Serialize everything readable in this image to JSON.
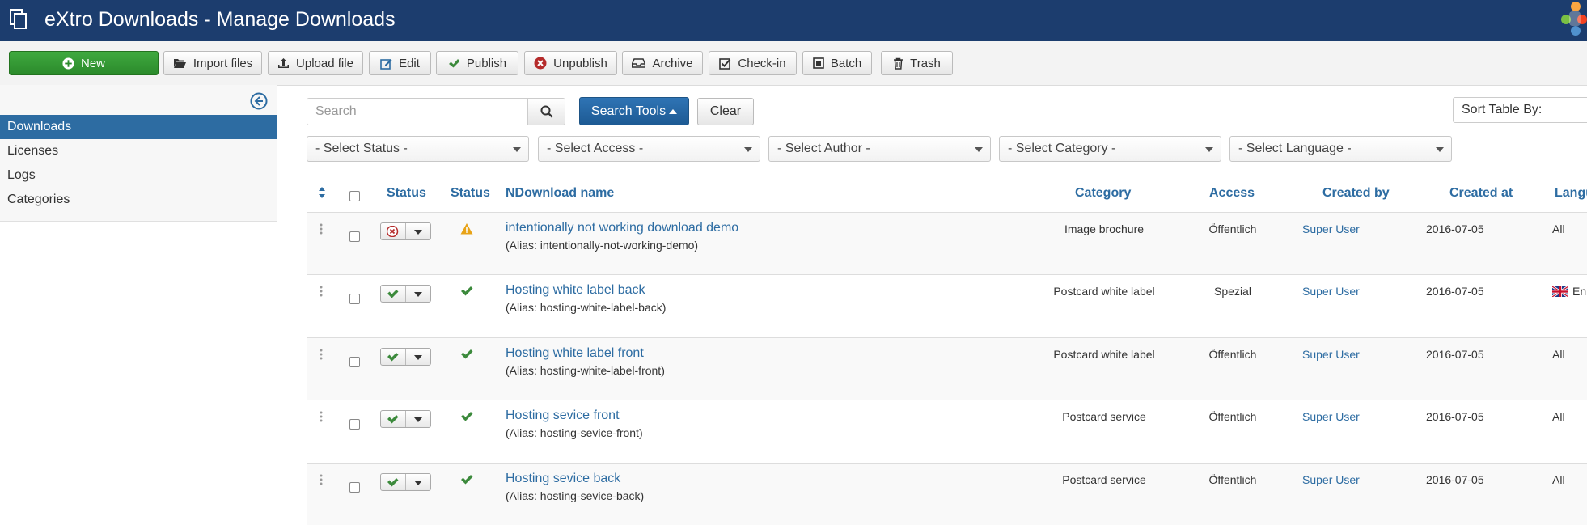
{
  "header": {
    "title": "eXtro Downloads - Manage Downloads"
  },
  "toolbar": {
    "new": "New",
    "import": "Import files",
    "upload": "Upload file",
    "edit": "Edit",
    "publish": "Publish",
    "unpublish": "Unpublish",
    "archive": "Archive",
    "checkin": "Check-in",
    "batch": "Batch",
    "trash": "Trash"
  },
  "sidebar": {
    "items": [
      {
        "label": "Downloads",
        "active": true
      },
      {
        "label": "Licenses",
        "active": false
      },
      {
        "label": "Logs",
        "active": false
      },
      {
        "label": "Categories",
        "active": false
      }
    ]
  },
  "search": {
    "placeholder": "Search",
    "value": "",
    "tools_label": "Search Tools",
    "clear_label": "Clear",
    "sort_label": "Sort Table By:"
  },
  "filters": {
    "status": "- Select Status -",
    "access": "- Select Access -",
    "author": "- Select Author -",
    "category": "- Select Category -",
    "language": "- Select Language -"
  },
  "table": {
    "headers": {
      "status1": "Status",
      "status2": "Status",
      "name": "NDownload name",
      "category": "Category",
      "access": "Access",
      "created_by": "Created by",
      "created_at": "Created at",
      "language": "Langu"
    },
    "rows": [
      {
        "published": "unpublished",
        "file_state": "warning",
        "name": "intentionally not working download demo",
        "alias": "(Alias: intentionally-not-working-demo)",
        "category": "Image brochure",
        "access": "Öffentlich",
        "created_by": "Super User",
        "created_at": "2016-07-05",
        "language": "All",
        "language_flag": ""
      },
      {
        "published": "published",
        "file_state": "ok",
        "name": "Hosting white label back",
        "alias": "(Alias: hosting-white-label-back)",
        "category": "Postcard white label",
        "access": "Spezial",
        "created_by": "Super User",
        "created_at": "2016-07-05",
        "language": "En",
        "language_flag": "uk-flag-icon"
      },
      {
        "published": "published",
        "file_state": "ok",
        "name": "Hosting white label front",
        "alias": "(Alias: hosting-white-label-front)",
        "category": "Postcard white label",
        "access": "Öffentlich",
        "created_by": "Super User",
        "created_at": "2016-07-05",
        "language": "All",
        "language_flag": ""
      },
      {
        "published": "published",
        "file_state": "ok",
        "name": "Hosting sevice front",
        "alias": "(Alias: hosting-sevice-front)",
        "category": "Postcard service",
        "access": "Öffentlich",
        "created_by": "Super User",
        "created_at": "2016-07-05",
        "language": "All",
        "language_flag": ""
      },
      {
        "published": "published",
        "file_state": "ok",
        "name": "Hosting sevice back",
        "alias": "(Alias: hosting-sevice-back)",
        "category": "Postcard service",
        "access": "Öffentlich",
        "created_by": "Super User",
        "created_at": "2016-07-05",
        "language": "All",
        "language_flag": ""
      }
    ]
  },
  "colors": {
    "header": "#1c3d6e",
    "accent": "#2d6ca2",
    "new_button": "#2b8a2b",
    "success": "#3c8a3c",
    "danger": "#b52b2b",
    "warning": "#e8a317"
  }
}
